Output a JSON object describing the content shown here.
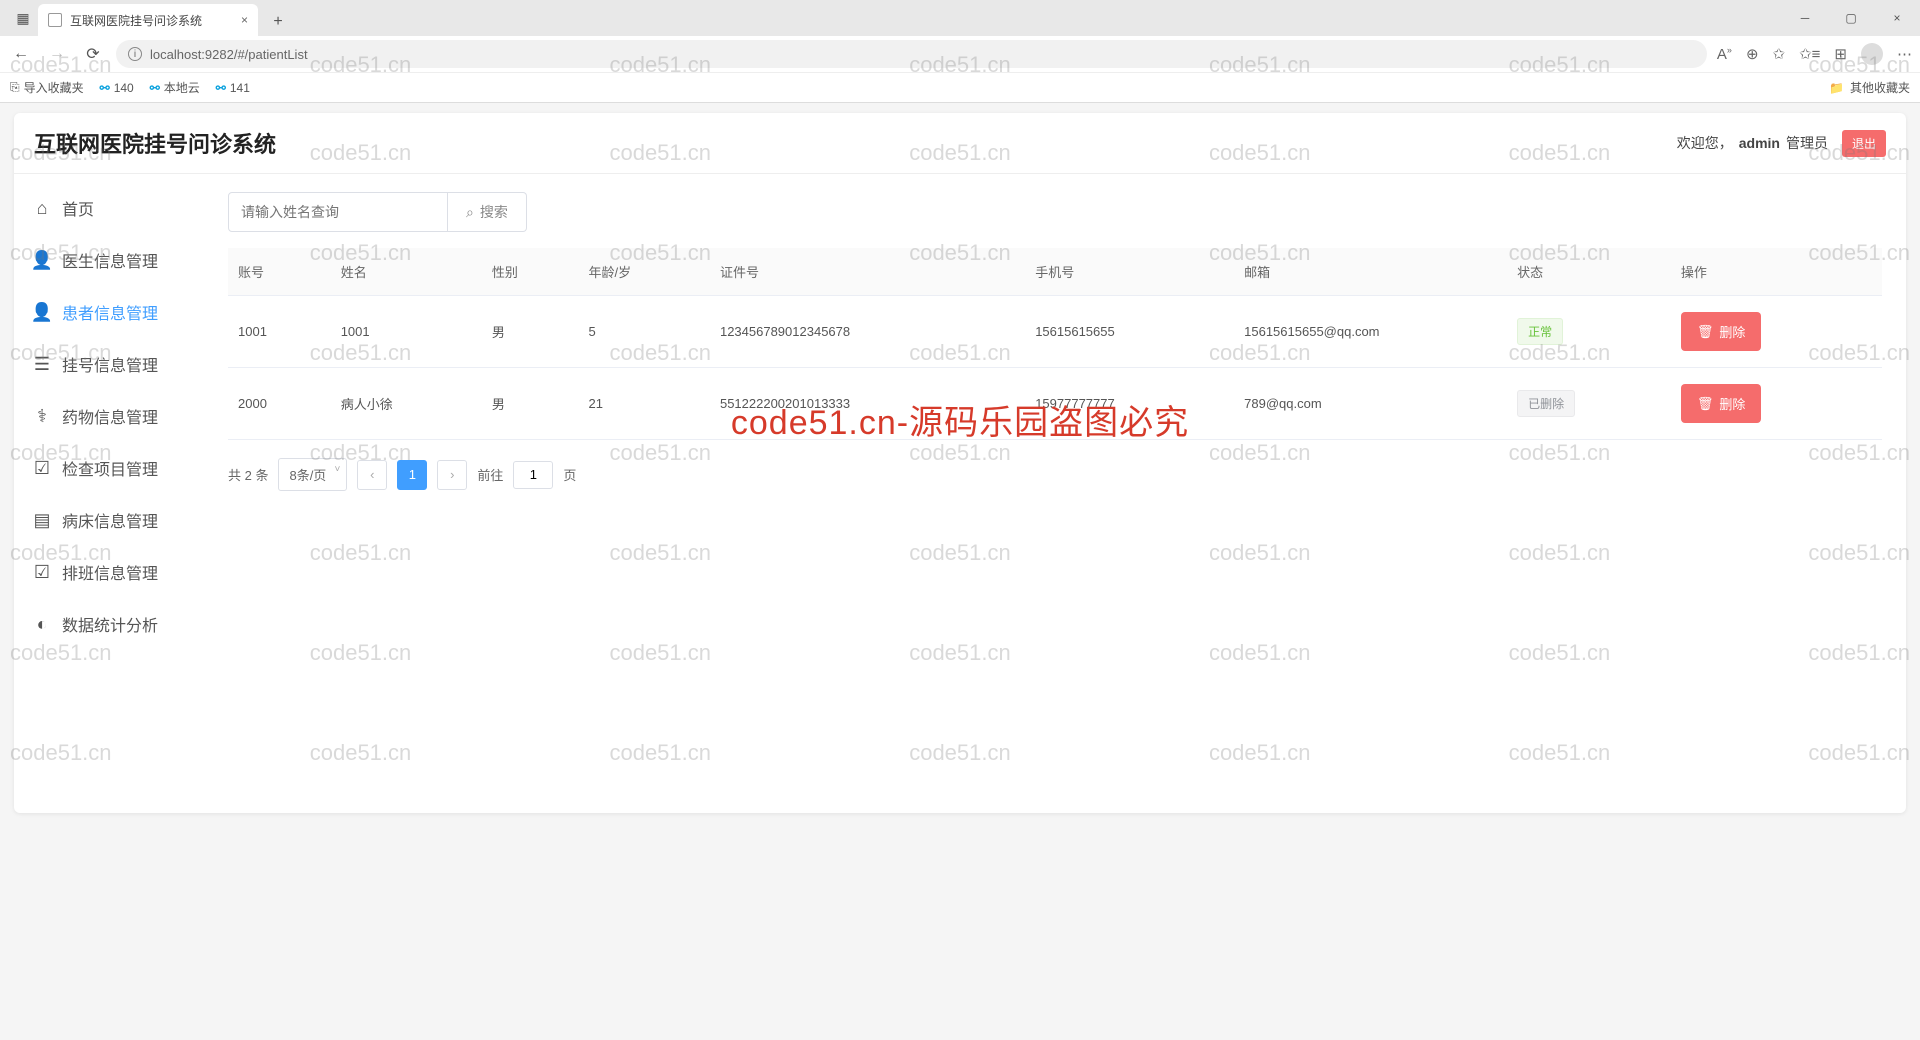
{
  "browser": {
    "tab_title": "互联网医院挂号问诊系统",
    "url": "localhost:9282/#/patientList",
    "bookmarks": {
      "import": "导入收藏夹",
      "b1": "140",
      "b2": "本地云",
      "b3": "141",
      "right": "其他收藏夹"
    }
  },
  "app": {
    "title": "互联网医院挂号问诊系统",
    "welcome": "欢迎您，",
    "username": "admin",
    "role": "管理员",
    "logout": "退出"
  },
  "sidebar": {
    "items": [
      {
        "label": "首页"
      },
      {
        "label": "医生信息管理"
      },
      {
        "label": "患者信息管理"
      },
      {
        "label": "挂号信息管理"
      },
      {
        "label": "药物信息管理"
      },
      {
        "label": "检查项目管理"
      },
      {
        "label": "病床信息管理"
      },
      {
        "label": "排班信息管理"
      },
      {
        "label": "数据统计分析"
      }
    ]
  },
  "search": {
    "placeholder": "请输入姓名查询",
    "button": "搜索"
  },
  "table": {
    "headers": {
      "account": "账号",
      "name": "姓名",
      "gender": "性别",
      "age": "年龄/岁",
      "idno": "证件号",
      "phone": "手机号",
      "email": "邮箱",
      "status": "状态",
      "action": "操作"
    },
    "rows": [
      {
        "account": "1001",
        "name": "1001",
        "gender": "男",
        "age": "5",
        "idno": "123456789012345678",
        "phone": "15615615655",
        "email": "15615615655@qq.com",
        "status": "正常",
        "status_class": "normal"
      },
      {
        "account": "2000",
        "name": "病人小徐",
        "gender": "男",
        "age": "21",
        "idno": "551222200201013333",
        "phone": "15977777777",
        "email": "789@qq.com",
        "status": "已删除",
        "status_class": "deleted"
      }
    ],
    "delete_label": "删除"
  },
  "pagination": {
    "total": "共 2 条",
    "per_page": "8条/页",
    "current": "1",
    "goto": "前往",
    "goto_value": "1",
    "page_suffix": "页"
  },
  "watermark": {
    "text": "code51.cn",
    "center": "code51.cn-源码乐园盗图必究"
  }
}
